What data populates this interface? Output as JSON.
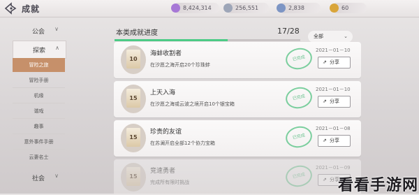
{
  "header": {
    "title": "成就",
    "resources": [
      {
        "icon": "purple-crystal-icon",
        "value": "8,424,314",
        "color": "#a778d6"
      },
      {
        "icon": "silver-coin-icon",
        "value": "256,551",
        "color": "#9ea6b8"
      },
      {
        "icon": "blue-gem-icon",
        "value": "2,838",
        "color": "#7d95c4"
      },
      {
        "icon": "gold-coin-icon",
        "value": "60",
        "color": "#d9a53a"
      }
    ]
  },
  "sidebar": {
    "categories": [
      {
        "label": "公会",
        "chevron": "∨"
      },
      {
        "label": "探索",
        "chevron": "∧"
      },
      {
        "label": "社会",
        "chevron": "∨"
      }
    ],
    "items": [
      "冒险之旅",
      "冒险手册",
      "机缘",
      "谐戏",
      "趣事",
      "意外事件手册",
      "云妻名士"
    ]
  },
  "progress": {
    "title": "本类成就进度",
    "count": "17/28",
    "value": 0.61,
    "fill_color": "#4ccb86"
  },
  "filter": {
    "label": "全部",
    "chevron": "⌄"
  },
  "achievements": [
    {
      "badge": "10",
      "title": "海蚌收割者",
      "desc": "在汐愿之海开启20个珍珠蚌",
      "stamp": "已完成",
      "date": "2021－01－10",
      "share": "分享",
      "share_icon": "⇗"
    },
    {
      "badge": "15",
      "title": "上天入海",
      "desc": "在汐愿之海或云波之境开启10个银宝箱",
      "stamp": "已完成",
      "date": "2021－01－10",
      "share": "分享",
      "share_icon": "⇗"
    },
    {
      "badge": "15",
      "title": "珍贵的友谊",
      "desc": "在苏澜开启全部12个协力宝箱",
      "stamp": "已完成",
      "date": "2021－01－08",
      "share": "分享",
      "share_icon": "⇗"
    },
    {
      "badge": "15",
      "title": "竞速勇者",
      "desc": "完成所有限时挑战",
      "stamp": "已完成",
      "date": "2021－01－09",
      "share": "分享",
      "share_icon": "⇗"
    }
  ],
  "watermark": "看看手游网"
}
